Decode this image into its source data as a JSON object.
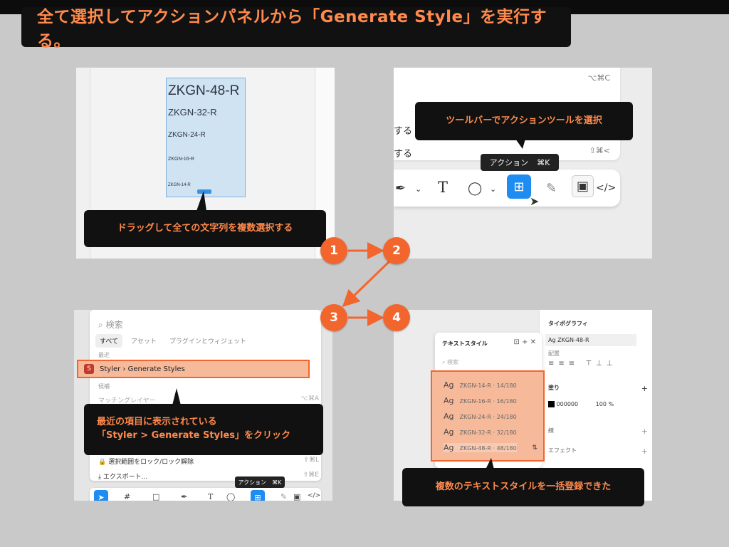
{
  "title": "全て選択してアクションパネルから「Generate Style」を実行する。",
  "steps": [
    "1",
    "2",
    "3",
    "4"
  ],
  "panel1": {
    "texts": [
      "ZKGN-48-R",
      "ZKGN-32-R",
      "ZKGN-24-R",
      "ZKGN-16-R",
      "ZKGN-14-R"
    ],
    "callout": "ドラッグして全ての文字列を複数選択する"
  },
  "panel2": {
    "menu_rows": [
      {
        "label": "",
        "shortcut": "⌥⌘C"
      },
      {
        "label": "する",
        "shortcut": ""
      },
      {
        "label": "する",
        "shortcut": "⇧⌘<"
      }
    ],
    "tooltip_label": "アクション",
    "tooltip_shortcut": "⌘K",
    "callout": "ツールバーでアクションツールを選択"
  },
  "panel3": {
    "search_placeholder": "検索",
    "tabs": [
      "すべて",
      "アセット",
      "プラグインとウィジェット"
    ],
    "section_recent": "最近",
    "highlight_item": "Styler › Generate Styles",
    "section_candidates": "候補",
    "candidate_item": "マッチングレイヤー",
    "candidate_shortcut": "⌥⌘A",
    "rows": [
      {
        "label": "選択範囲をロック/ロック解除",
        "shortcut": "⇧⌘L"
      },
      {
        "label": "エクスポート...",
        "shortcut": "⇧⌘E"
      }
    ],
    "tooltip_label": "アクション",
    "tooltip_shortcut": "⌘K",
    "callout_line1": "最近の項目に表示されている",
    "callout_line2": "「Styler > Generate Styles」をクリック"
  },
  "panel4": {
    "window_title": "テキストスタイル",
    "search_placeholder": "検索",
    "styles": [
      {
        "ag": "Ag",
        "name": "ZKGN-14-R · 14/180"
      },
      {
        "ag": "Ag",
        "name": "ZKGN-16-R · 16/180"
      },
      {
        "ag": "Ag",
        "name": "ZKGN-24-R · 24/180"
      },
      {
        "ag": "Ag",
        "name": "ZKGN-32-R · 32/180"
      },
      {
        "ag": "Ag",
        "name": "ZKGN-48-R · 48/180"
      }
    ],
    "typography_label": "タイポグラフィ",
    "current_style": "Ag ZKGN-48-R",
    "align_label": "配置",
    "fill_label": "塗り",
    "fill_hex": "000000",
    "fill_opacity": "100",
    "fill_unit": "%",
    "stroke_label": "線",
    "effect_label": "エフェクト",
    "callout": "複数のテキストスタイルを一括登録できた"
  },
  "colors": {
    "accent": "#f2662e",
    "callout_text": "#ff8a4c",
    "action_blue": "#1e8cf0"
  }
}
